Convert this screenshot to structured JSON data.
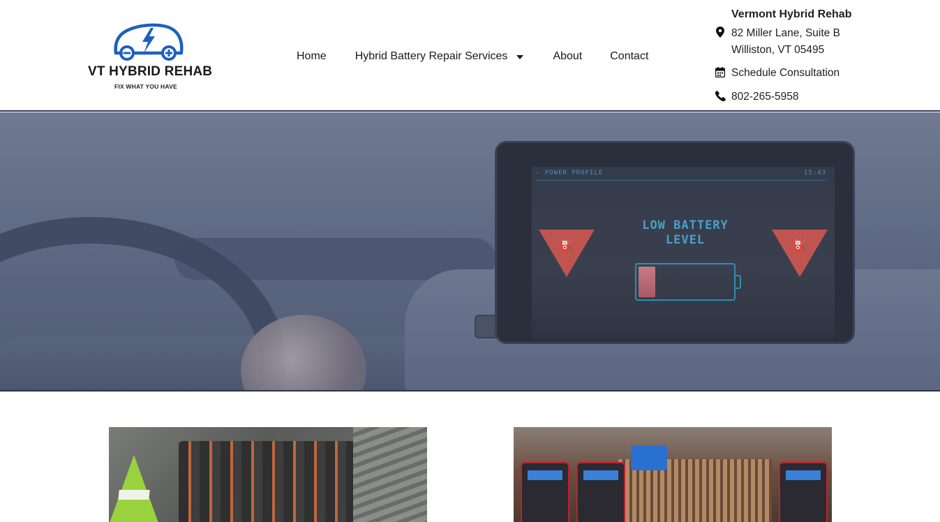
{
  "logo": {
    "title": "VT HYBRID REHAB",
    "tagline": "FIX WHAT YOU HAVE",
    "icon": "car-lightning-icon",
    "color": "#1f5fbf"
  },
  "nav": {
    "home": "Home",
    "services": "Hybrid Battery Repair Services",
    "about": "About",
    "contact": "Contact"
  },
  "contact": {
    "business_name": "Vermont Hybrid Rehab",
    "address_line1": "82 Miller Lane, Suite B",
    "address_line2": "Williston, VT 05495",
    "schedule": "Schedule Consultation",
    "phone": "802-265-5958"
  },
  "hero": {
    "screen_header_left": "‹ POWER PROFILE",
    "screen_header_right": "15:43",
    "screen_message_line1": "LOW BATTERY",
    "screen_message_line2": "LEVEL",
    "overlay_color": "#4f5a73",
    "warning_color": "#c0554f"
  },
  "gallery": {
    "photo1": "battery-pack-photo",
    "photo2": "battery-chargers-photo"
  }
}
